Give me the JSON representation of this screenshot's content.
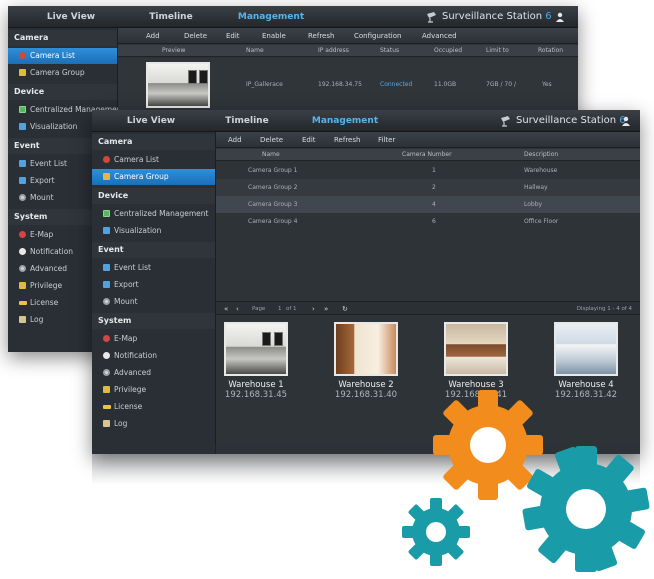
{
  "back_window": {
    "nav": {
      "tabs": [
        "Live View",
        "Timeline",
        "Management"
      ],
      "active": "Management",
      "brand": "Surveillance Station",
      "version": "6"
    },
    "toolbar": [
      "Add",
      "Delete",
      "Edit",
      "Enable",
      "Refresh",
      "Configuration",
      "Advanced"
    ],
    "sidebar": {
      "camera_section": "Camera",
      "camera_items": [
        "Camera List",
        "Camera Group"
      ],
      "device_section": "Device",
      "device_items": [
        "Centralized Management",
        "Visualization"
      ],
      "event_section": "Event",
      "event_items": [
        "Event List",
        "Export",
        "Mount"
      ],
      "system_section": "System",
      "system_items": [
        "E-Map",
        "Notification",
        "Advanced",
        "Privilege",
        "License",
        "Log"
      ]
    },
    "table": {
      "headers": [
        "Preview",
        "Name",
        "IP address",
        "Status",
        "Occupied",
        "Limit to",
        "Rotation"
      ],
      "row": [
        "IP_Gallerace",
        "192.168.34.75",
        "Connected",
        "11.0GB",
        "7GB / 70 /",
        "Yes"
      ]
    }
  },
  "front_window": {
    "nav": {
      "tabs": [
        "Live View",
        "Timeline",
        "Management"
      ],
      "active": "Management",
      "brand": "Surveillance Station",
      "version": "6"
    },
    "toolbar": [
      "Add",
      "Delete",
      "Edit",
      "Refresh",
      "Filter"
    ],
    "sidebar": {
      "camera_section": "Camera",
      "camera_items": [
        "Camera List",
        "Camera Group"
      ],
      "device_section": "Device",
      "device_items": [
        "Centralized Management",
        "Visualization"
      ],
      "event_section": "Event",
      "event_items": [
        "Event List",
        "Export",
        "Mount"
      ],
      "system_section": "System",
      "system_items": [
        "E-Map",
        "Notification",
        "Advanced",
        "Privilege",
        "License",
        "Log"
      ]
    },
    "table": {
      "headers": [
        "Name",
        "Camera Number",
        "Description"
      ],
      "rows": [
        [
          "Camera Group 1",
          "1",
          "Warehouse"
        ],
        [
          "Camera Group 2",
          "2",
          "Hallway"
        ],
        [
          "Camera Group 3",
          "4",
          "Lobby"
        ],
        [
          "Camera Group 4",
          "6",
          "Office Floor"
        ]
      ]
    },
    "pager": {
      "page_label": "Page",
      "page_value": "1",
      "of_label": "of 1",
      "displaying": "Displaying 1 - 4 of 4"
    },
    "cameras": [
      {
        "name": "Warehouse 1",
        "ip": "192.168.31.45"
      },
      {
        "name": "Warehouse 2",
        "ip": "192.168.31.40"
      },
      {
        "name": "Warehouse 3",
        "ip": "192.168.31.41"
      },
      {
        "name": "Warehouse 4",
        "ip": "192.168.31.42"
      }
    ]
  },
  "colors": {
    "accent": "#4aa8e6",
    "gear_orange": "#f28c1c",
    "gear_teal": "#1a9ba8",
    "selection": "#2f8fd8"
  },
  "icons": [
    "user-icon",
    "surveillance-camera-logo-icon",
    "first-page-icon",
    "prev-page-icon",
    "next-page-icon",
    "last-page-icon",
    "refresh-icon",
    "gear-icon"
  ]
}
